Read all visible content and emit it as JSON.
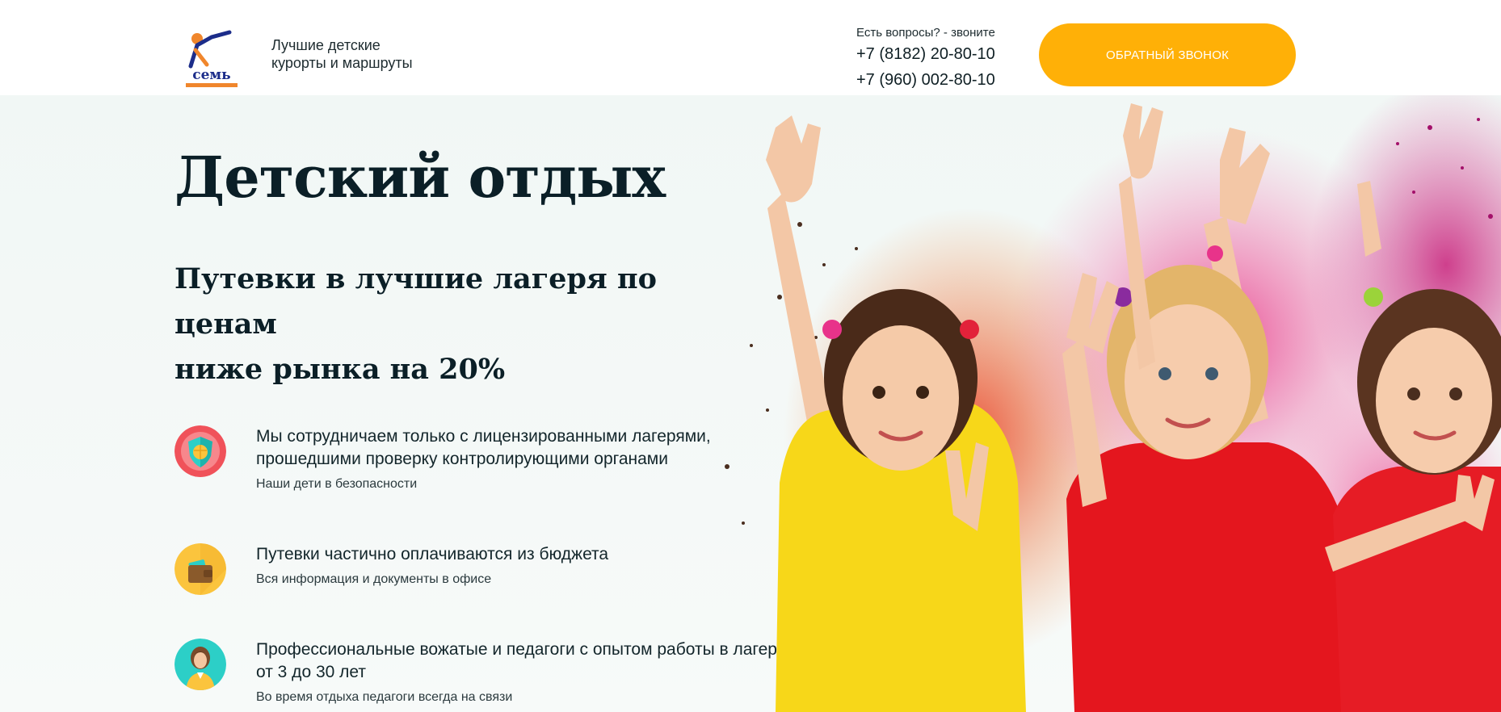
{
  "header": {
    "tagline_line1": "Лучшие детские",
    "tagline_line2": "курорты и маршруты",
    "contact_prompt": "Есть вопросы? - звоните",
    "phone1": "+7 (8182) 20-80-10",
    "phone2": "+7 (960) 002-80-10",
    "callback_label": "ОБРАТНЫЙ ЗВОНОК"
  },
  "hero": {
    "title": "Детский отдых",
    "subtitle_line1": "Путевки в лучшие лагеря по ценам",
    "subtitle_line2": "ниже рынка на 20%"
  },
  "features": [
    {
      "icon": "shield-icon",
      "title_line1": "Мы сотрудничаем только с лицензированными лагерями,",
      "title_line2": "прошедшими проверку контролирующими органами",
      "desc": "Наши дети в безопасности"
    },
    {
      "icon": "wallet-icon",
      "title_line1": "Путевки частично оплачиваются из бюджета",
      "desc": "Вся информация и документы в офисе"
    },
    {
      "icon": "teacher-icon",
      "title_line1": "Профессиональные вожатые и педагоги с опытом работы в лагерях",
      "title_line2": "от 3 до 30 лет",
      "desc": "Во время отдыха педагоги всегда на связи"
    }
  ],
  "colors": {
    "accent": "#ffb007",
    "icon_red": "#f0525a",
    "icon_yellow": "#fbc43d",
    "icon_teal": "#2ccfc7",
    "text_dark": "#0b1f27"
  }
}
